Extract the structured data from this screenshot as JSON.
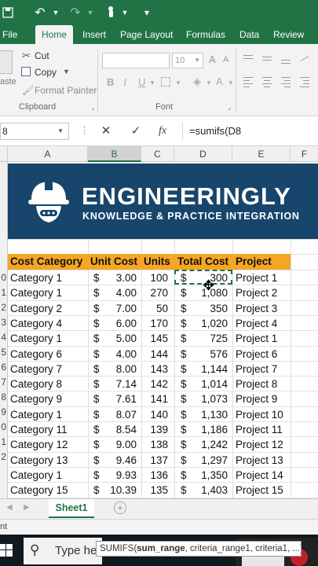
{
  "ribbon_tabs": [
    "File",
    "Home",
    "Insert",
    "Page Layout",
    "Formulas",
    "Data",
    "Review"
  ],
  "clipboard": {
    "paste": "aste",
    "cut": "Cut",
    "copy": "Copy",
    "format_painter": "Format Painter",
    "group": "Clipboard"
  },
  "font": {
    "name": "",
    "size": "10",
    "group": "Font",
    "bold": "B",
    "italic": "I",
    "underline": "U"
  },
  "formula_bar": {
    "name_box": "8",
    "formula": "=sumifs(D8",
    "cancel": "✕",
    "enter": "✓",
    "fx": "fx"
  },
  "columns": [
    "A",
    "B",
    "C",
    "D",
    "E",
    "F"
  ],
  "row_numbers": [
    "",
    "",
    "",
    "",
    "",
    "",
    "",
    "",
    "",
    "",
    "",
    "",
    "",
    "",
    "",
    "",
    "",
    ""
  ],
  "row_number_digits": [
    "",
    "",
    "",
    "",
    "",
    "",
    "0",
    "1",
    "2",
    "3",
    "4",
    "5",
    "6",
    "7",
    "8",
    "9",
    "0",
    "1",
    "2"
  ],
  "banner": {
    "brand": "ENGINEERINGLY",
    "tagline": "KNOWLEDGE & PRACTICE INTEGRATION"
  },
  "table": {
    "headers": [
      "Cost Category",
      "Unit Cost",
      "Units",
      "Total Cost",
      "Project"
    ],
    "rows": [
      [
        "Category 1",
        "$",
        "3.00",
        "100",
        "$",
        "300",
        "Project 1"
      ],
      [
        "Category 1",
        "$",
        "4.00",
        "270",
        "$",
        "1,080",
        "Project 2"
      ],
      [
        "Category 2",
        "$",
        "7.00",
        "50",
        "$",
        "350",
        "Project 3"
      ],
      [
        "Category 4",
        "$",
        "6.00",
        "170",
        "$",
        "1,020",
        "Project 4"
      ],
      [
        "Category 1",
        "$",
        "5.00",
        "145",
        "$",
        "725",
        "Project 1"
      ],
      [
        "Category 6",
        "$",
        "4.00",
        "144",
        "$",
        "576",
        "Project 6"
      ],
      [
        "Category 7",
        "$",
        "8.00",
        "143",
        "$",
        "1,144",
        "Project 7"
      ],
      [
        "Category 8",
        "$",
        "7.14",
        "142",
        "$",
        "1,014",
        "Project 8"
      ],
      [
        "Category 9",
        "$",
        "7.61",
        "141",
        "$",
        "1,073",
        "Project 9"
      ],
      [
        "Category 1",
        "$",
        "8.07",
        "140",
        "$",
        "1,130",
        "Project 10"
      ],
      [
        "Category 11",
        "$",
        "8.54",
        "139",
        "$",
        "1,186",
        "Project 11"
      ],
      [
        "Category 12",
        "$",
        "9.00",
        "138",
        "$",
        "1,242",
        "Project 12"
      ],
      [
        "Category 13",
        "$",
        "9.46",
        "137",
        "$",
        "1,297",
        "Project 13"
      ],
      [
        "Category 1",
        "$",
        "9.93",
        "136",
        "$",
        "1,350",
        "Project 14"
      ],
      [
        "Category 15",
        "$",
        "10.39",
        "135",
        "$",
        "1,403",
        "Project 15"
      ]
    ]
  },
  "sheets": [
    "Sheet1"
  ],
  "status": "nt",
  "taskbar": {
    "search_text": "Type he"
  },
  "tooltip": {
    "func": "SUMIFS(",
    "bold_arg": "sum_range",
    "rest": ", criteria_range1, criteria1, ...)"
  },
  "colors": {
    "excel_green": "#217346",
    "banner_blue": "#17456b",
    "header_orange": "#f5a623"
  }
}
